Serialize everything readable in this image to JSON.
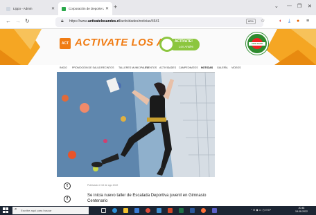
{
  "browser": {
    "tabs": [
      {
        "label": "Lippo - Admin",
        "active": false
      },
      {
        "label": "Corporación de Deporte Los A",
        "active": true
      }
    ],
    "new_tab_icon": "plus-icon",
    "url_prefix": "https://www.",
    "url_domain": "activatelosandes.cl",
    "url_path": "/actividades/noticias/4641",
    "zoom_label": "80%",
    "window_controls": [
      "minimize-icon",
      "maximize-icon",
      "close-icon"
    ]
  },
  "site": {
    "logo_badge": "ACT",
    "brand": "ACTIVATE LOS ANDES",
    "activate_logo": {
      "line1": "ACTÍVATE!",
      "line2": "Los Andes"
    },
    "seal_text": "VIVE SANO",
    "menu": [
      {
        "label": "INICIO",
        "active": false
      },
      {
        "label": "PROMOCIÓN DE SALUD",
        "active": false
      },
      {
        "label": "RECINTOS",
        "active": false
      },
      {
        "label": "TALLERES MUNICIPALES",
        "active": false
      },
      {
        "label": "EVENTOS",
        "active": false
      },
      {
        "label": "ACTIVIDADES",
        "active": false
      },
      {
        "label": "CAMPEONATOS",
        "active": false
      },
      {
        "label": "NOTICIAS",
        "active": true
      },
      {
        "label": "GALERÍA",
        "active": false
      },
      {
        "label": "VIDEOS",
        "active": false
      }
    ]
  },
  "article": {
    "date": "Publicado el 18 de ago 2022",
    "title": "Se inicia nuevo taller de Escalada Deportiva juvenil en Gimnasio Centenario",
    "share": [
      {
        "icon": "twitter-icon",
        "glyph": "t"
      },
      {
        "icon": "facebook-icon",
        "glyph": "f"
      }
    ]
  },
  "taskbar": {
    "search_placeholder": "Escribe aquí para buscar",
    "tray_text": "^  ⊕  ◆  ▭  ◷  ESP",
    "time": "20:48",
    "date": "18-08-2022"
  },
  "colors": {
    "brand_orange": "#f07c14",
    "accent_green": "#8cc63f",
    "taskbar": "#1c2533"
  }
}
